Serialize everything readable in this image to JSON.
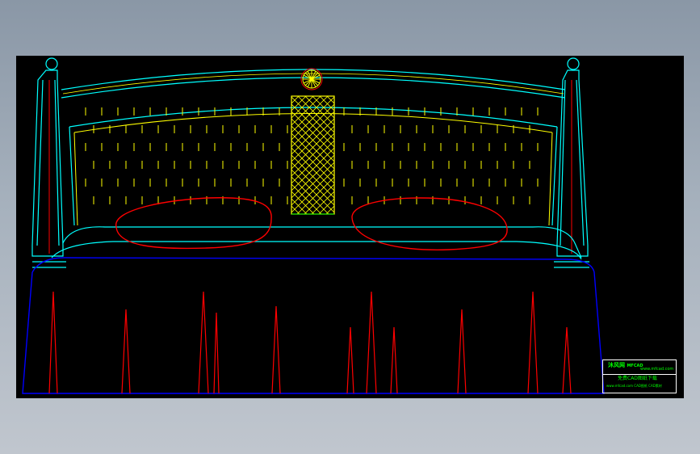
{
  "colors": {
    "canvas": "#000000",
    "frame": "#00ffff",
    "fabric": "#ffff00",
    "pillow": "#ff0000",
    "cover": "#0000ff",
    "pleat": "#ff0000",
    "stamp": "#00ff00"
  },
  "title_block": {
    "brand_cn": "沐风网",
    "brand_en": "MFCAD",
    "site": "www.mfcad.com",
    "line2": "免费CAD图纸下载",
    "line3": "www.mfcad.com CAD图纸 CAD素材"
  },
  "icons": [
    "rosette-icon",
    "stamp-logo-icon"
  ]
}
